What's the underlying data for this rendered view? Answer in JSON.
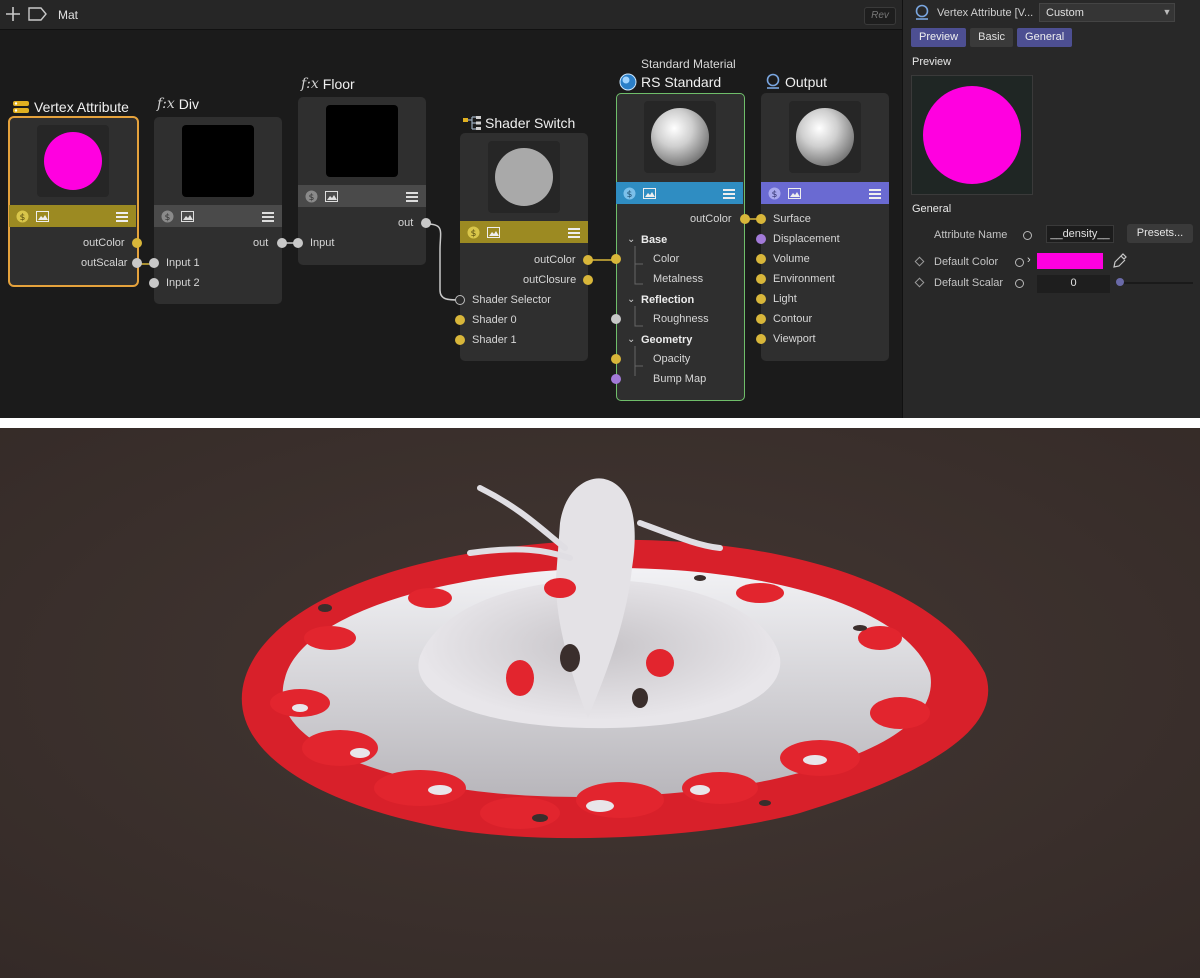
{
  "topbar": {
    "title": "Mat",
    "rev_label": "Rev",
    "icons": [
      "plus-icon",
      "tag-icon"
    ]
  },
  "nodes": {
    "vertex_attribute": {
      "title": "Vertex Attribute",
      "outputs": [
        "outColor",
        "outScalar"
      ],
      "preview_color": "#ff00e0"
    },
    "div": {
      "prefix": "f:x",
      "title": "Div",
      "outputs": [
        "out"
      ],
      "inputs": [
        "Input 1",
        "Input 2"
      ]
    },
    "floor": {
      "prefix": "f:x",
      "title": "Floor",
      "outputs": [
        "out"
      ],
      "inputs": [
        "Input"
      ]
    },
    "shader_switch": {
      "title": "Shader Switch",
      "outputs": [
        "outColor",
        "outClosure"
      ],
      "inputs": [
        "Shader Selector",
        "Shader 0",
        "Shader 1"
      ]
    },
    "rs_standard": {
      "subtitle": "Standard Material",
      "title": "RS Standard",
      "outputs": [
        "outColor"
      ],
      "groups": [
        {
          "label": "Base",
          "items": [
            "Color",
            "Metalness"
          ]
        },
        {
          "label": "Reflection",
          "items": [
            "Roughness"
          ]
        },
        {
          "label": "Geometry",
          "items": [
            "Opacity",
            "Bump Map"
          ]
        }
      ]
    },
    "output": {
      "title": "Output",
      "inputs": [
        "Surface",
        "Displacement",
        "Volume",
        "Environment",
        "Light",
        "Contour",
        "Viewport"
      ]
    }
  },
  "panel": {
    "title": "Vertex Attribute [V...",
    "preset_select": "Custom",
    "tabs": [
      "Preview",
      "Basic",
      "General"
    ],
    "preview_heading": "Preview",
    "general_heading": "General",
    "attribute_name_label": "Attribute Name",
    "attribute_name_value": "__density__",
    "presets_button": "Presets...",
    "default_color_label": "Default Color",
    "default_color_value": "#ff00e0",
    "default_scalar_label": "Default Scalar",
    "default_scalar_value": "0"
  },
  "colors": {
    "selection_outline": "#e5a23c",
    "material_outline": "#6fbe6a",
    "port_yellow": "#d8b63a",
    "port_purple": "#a27ad8",
    "bar_gold": "#9c8a22",
    "bar_blue": "#2f8dc2",
    "bar_violet": "#6a6ad2",
    "tab_active": "#4d4f92",
    "render_background": "#3b312e",
    "splash_red": "#e0252d",
    "splash_white": "#e6e6ea"
  }
}
